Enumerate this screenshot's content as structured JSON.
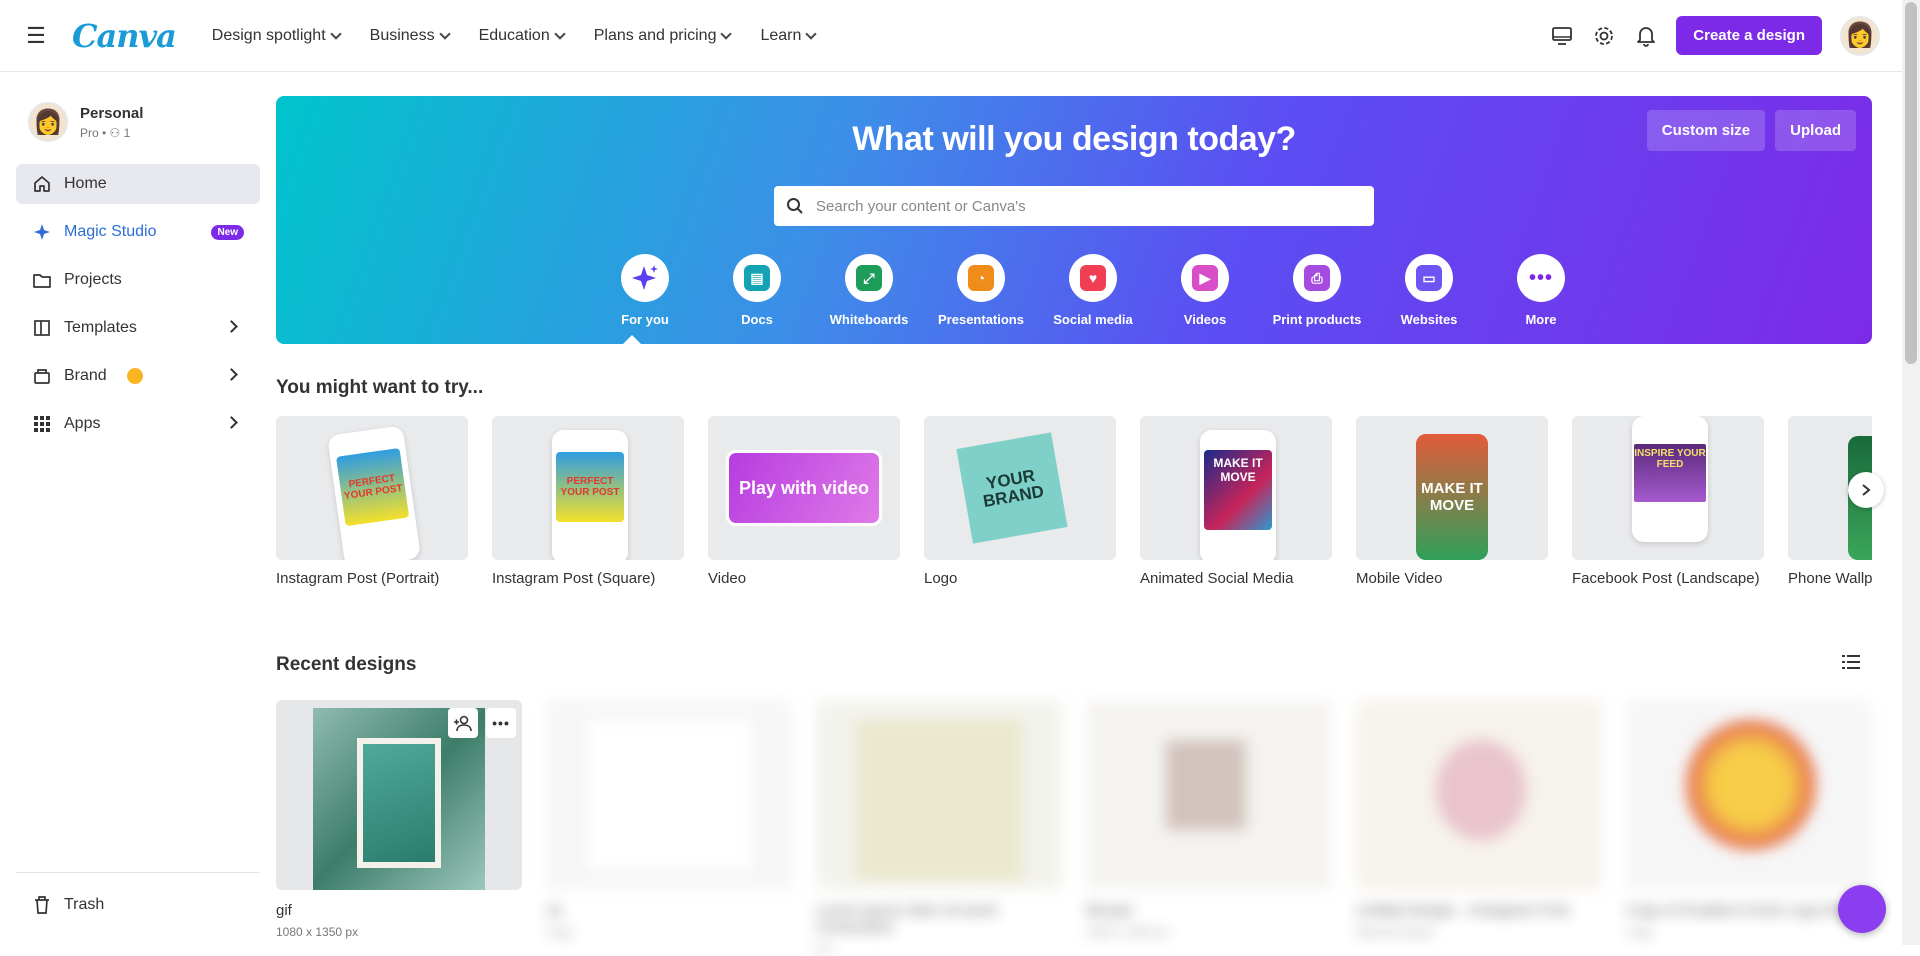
{
  "topbar": {
    "logo": "Canva",
    "nav": [
      {
        "label": "Design spotlight"
      },
      {
        "label": "Business"
      },
      {
        "label": "Education"
      },
      {
        "label": "Plans and pricing"
      },
      {
        "label": "Learn"
      }
    ],
    "create_label": "Create a design",
    "icons": [
      "monitor-icon",
      "gear-icon",
      "bell-icon"
    ]
  },
  "sidebar": {
    "account": {
      "name": "Personal",
      "sub": "Pro • ",
      "members": "1"
    },
    "items": [
      {
        "label": "Home",
        "icon": "home-icon",
        "active": true
      },
      {
        "label": "Magic Studio",
        "icon": "sparkle-icon",
        "badge": "New"
      },
      {
        "label": "Projects",
        "icon": "folder-icon"
      },
      {
        "label": "Templates",
        "icon": "templates-icon"
      },
      {
        "label": "Brand",
        "icon": "brand-icon"
      },
      {
        "label": "Apps",
        "icon": "apps-grid-icon"
      }
    ],
    "trash": "Trash"
  },
  "hero": {
    "title": "What will you design today?",
    "custom_size": "Custom size",
    "upload": "Upload",
    "search_placeholder": "Search your content or Canva's",
    "categories": [
      {
        "label": "For you",
        "color": "#7d2ae8",
        "icon": "sparkle-icon"
      },
      {
        "label": "Docs",
        "color": "#13a3b5",
        "icon": "doc-icon"
      },
      {
        "label": "Whiteboards",
        "color": "#1e9d5a",
        "icon": "whiteboard-icon"
      },
      {
        "label": "Presentations",
        "color": "#f08d1a",
        "icon": "presentation-icon"
      },
      {
        "label": "Social media",
        "color": "#f03e52",
        "icon": "heart-icon"
      },
      {
        "label": "Videos",
        "color": "#d84ec9",
        "icon": "video-icon"
      },
      {
        "label": "Print products",
        "color": "#a64be0",
        "icon": "printer-icon"
      },
      {
        "label": "Websites",
        "color": "#6c55f2",
        "icon": "website-icon"
      },
      {
        "label": "More",
        "color": "#7d2ae8",
        "icon": "more-icon"
      }
    ]
  },
  "try": {
    "title": "You might want to try...",
    "items": [
      {
        "label": "Instagram Post (Portrait)",
        "thumb_text": "PERFECT YOUR POST"
      },
      {
        "label": "Instagram Post (Square)",
        "thumb_text": "PERFECT YOUR POST"
      },
      {
        "label": "Video",
        "thumb_text": "Play with video"
      },
      {
        "label": "Logo",
        "thumb_text": "YOUR BRAND"
      },
      {
        "label": "Animated Social Media",
        "thumb_text": "MAKE IT MOVE"
      },
      {
        "label": "Mobile Video",
        "thumb_text": "MAKE IT MOVE"
      },
      {
        "label": "Facebook Post (Landscape)",
        "thumb_text": "INSPIRE YOUR FEED"
      },
      {
        "label": "Phone Wallpaper",
        "thumb_text": ""
      }
    ]
  },
  "recent": {
    "title": "Recent designs",
    "items": [
      {
        "title": "gif",
        "sub": "1080 x 1350 px"
      },
      {
        "title": "Ja",
        "sub": "Logo"
      },
      {
        "title": "Lorem ipsum dolor sit amet consectetur",
        "sub": "A4"
      },
      {
        "title": "Mosaic",
        "sub": "1920 x 1920 px"
      },
      {
        "title": "Untitled design - Instagram Post",
        "sub": "Wechat Avatar"
      },
      {
        "title": "Copy of Gradient Circle Logo Design",
        "sub": "Logo"
      }
    ]
  }
}
